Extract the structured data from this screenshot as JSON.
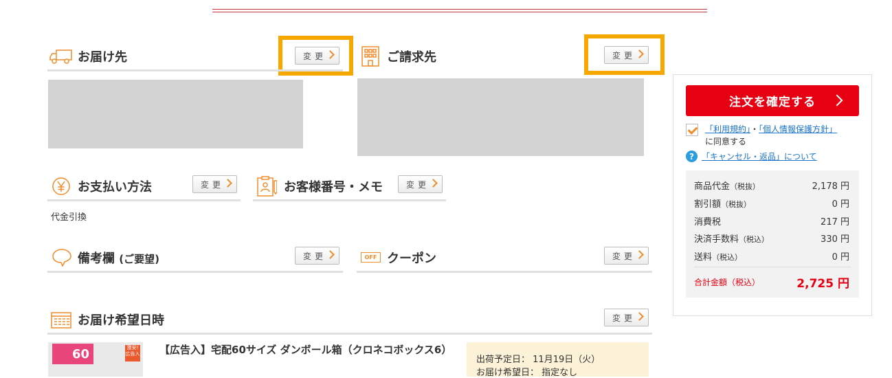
{
  "sections": {
    "delivery": {
      "title": "お届け先",
      "change": "変更"
    },
    "billing": {
      "title": "ご請求先",
      "change": "変更"
    },
    "payment": {
      "title": "お支払い方法",
      "change": "変更",
      "value": "代金引換"
    },
    "customer_no": {
      "title": "お客様番号・メモ",
      "change": "変更"
    },
    "remarks": {
      "title": "備考欄",
      "title_sub": "(ご要望)",
      "change": "変更"
    },
    "coupon": {
      "title": "クーポン",
      "change": "変更",
      "icon_text": "OFF"
    },
    "delivery_date": {
      "title": "お届け希望日時",
      "change": "変更"
    }
  },
  "product": {
    "name": "【広告入】宅配60サイズ ダンボール箱（クロネコボックス6）",
    "badge": "60",
    "cheap_badge": "激安!広告入",
    "ship_label": "出荷予定日：",
    "ship_date": "11月19日（火）",
    "deliver_label": "お届け希望日：",
    "deliver_value": "指定なし"
  },
  "sidebar": {
    "confirm_button": "注文を確定する",
    "terms_link": "「利用規約」",
    "separator": "・",
    "privacy_link": "「個人情報保護方針」",
    "agree_text": "に同意する",
    "agree_checked": true,
    "cancel_link": "「キャンセル・返品」について",
    "summary": [
      {
        "label": "商品代金",
        "note": "（税抜）",
        "value": "2,178 円"
      },
      {
        "label": "割引額",
        "note": "（税抜）",
        "value": "0 円"
      },
      {
        "label": "消費税",
        "note": "",
        "value": "217 円"
      },
      {
        "label": "決済手数料",
        "note": "（税込）",
        "value": "330 円"
      },
      {
        "label": "送料",
        "note": "（税込）",
        "value": "0 円"
      }
    ],
    "total_label": "合計金額",
    "total_note": "（税込）",
    "total_value": "2,725 円"
  },
  "colors": {
    "accent": "#f08c2a",
    "highlight": "#f6a800",
    "confirm": "#e60012",
    "link": "#1a73c8"
  }
}
